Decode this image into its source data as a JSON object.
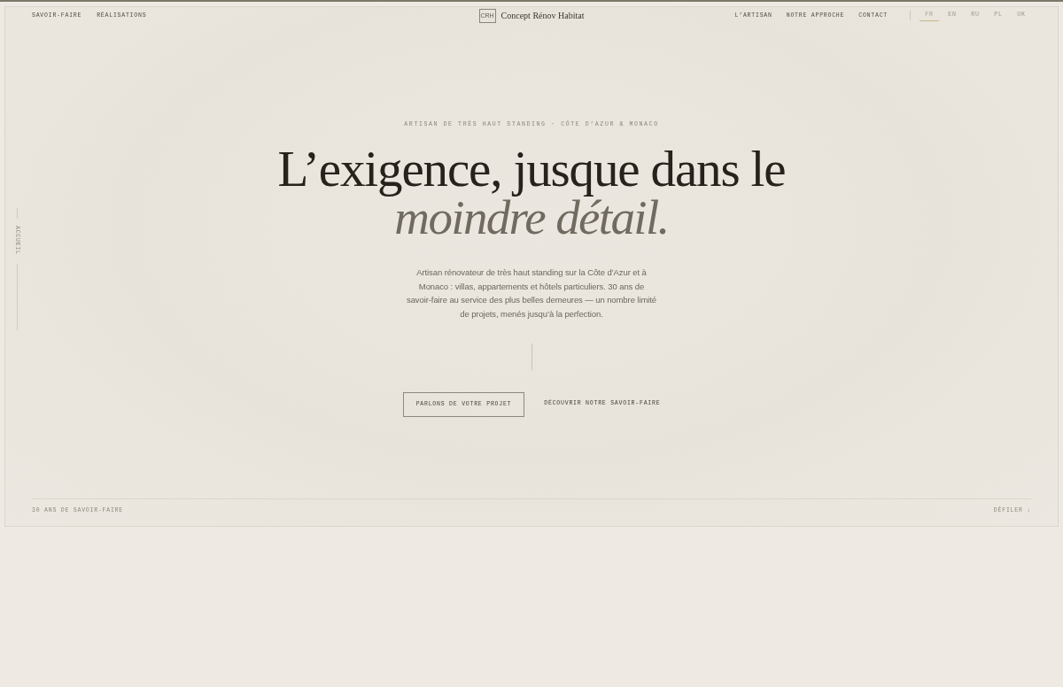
{
  "header": {
    "left_nav": [
      "SAVOIR-FAIRE",
      "RÉALISATIONS"
    ],
    "logo": {
      "monogram": "CRH",
      "name": "Concept Rénov Habitat"
    },
    "right_nav": [
      "L’ARTISAN",
      "NOTRE APPROCHE",
      "CONTACT"
    ],
    "languages": [
      {
        "code": "FR",
        "selected": true
      },
      {
        "code": "EN",
        "selected": false
      },
      {
        "code": "RU",
        "selected": false
      },
      {
        "code": "PL",
        "selected": false
      },
      {
        "code": "UK",
        "selected": false
      }
    ]
  },
  "side_indicator": {
    "label": "ACCUEIL"
  },
  "hero": {
    "eyebrow": "ARTISAN DE TRÈS HAUT STANDING · CÔTE D’AZUR & MONACO",
    "title_line_1": "L’exigence, jusque dans le",
    "title_line_2": "moindre détail.",
    "intro_lines": [
      "Artisan rénovateur de très haut standing sur la Côte d’Azur et à",
      "Monaco : villas, appartements et hôtels particuliers. 30 ans de",
      "savoir-faire au service des plus belles demeures — un nombre limité",
      "de projets, menés jusqu’à la perfection."
    ],
    "primary_button": "PARLONS DE VOTRE PROJET",
    "secondary_link": "DÉCOUVRIR NOTRE SAVOIR-FAIRE"
  },
  "footer": {
    "left": "30 ANS DE SAVOIR-FAIRE",
    "right": "DÉFILER ↓"
  }
}
